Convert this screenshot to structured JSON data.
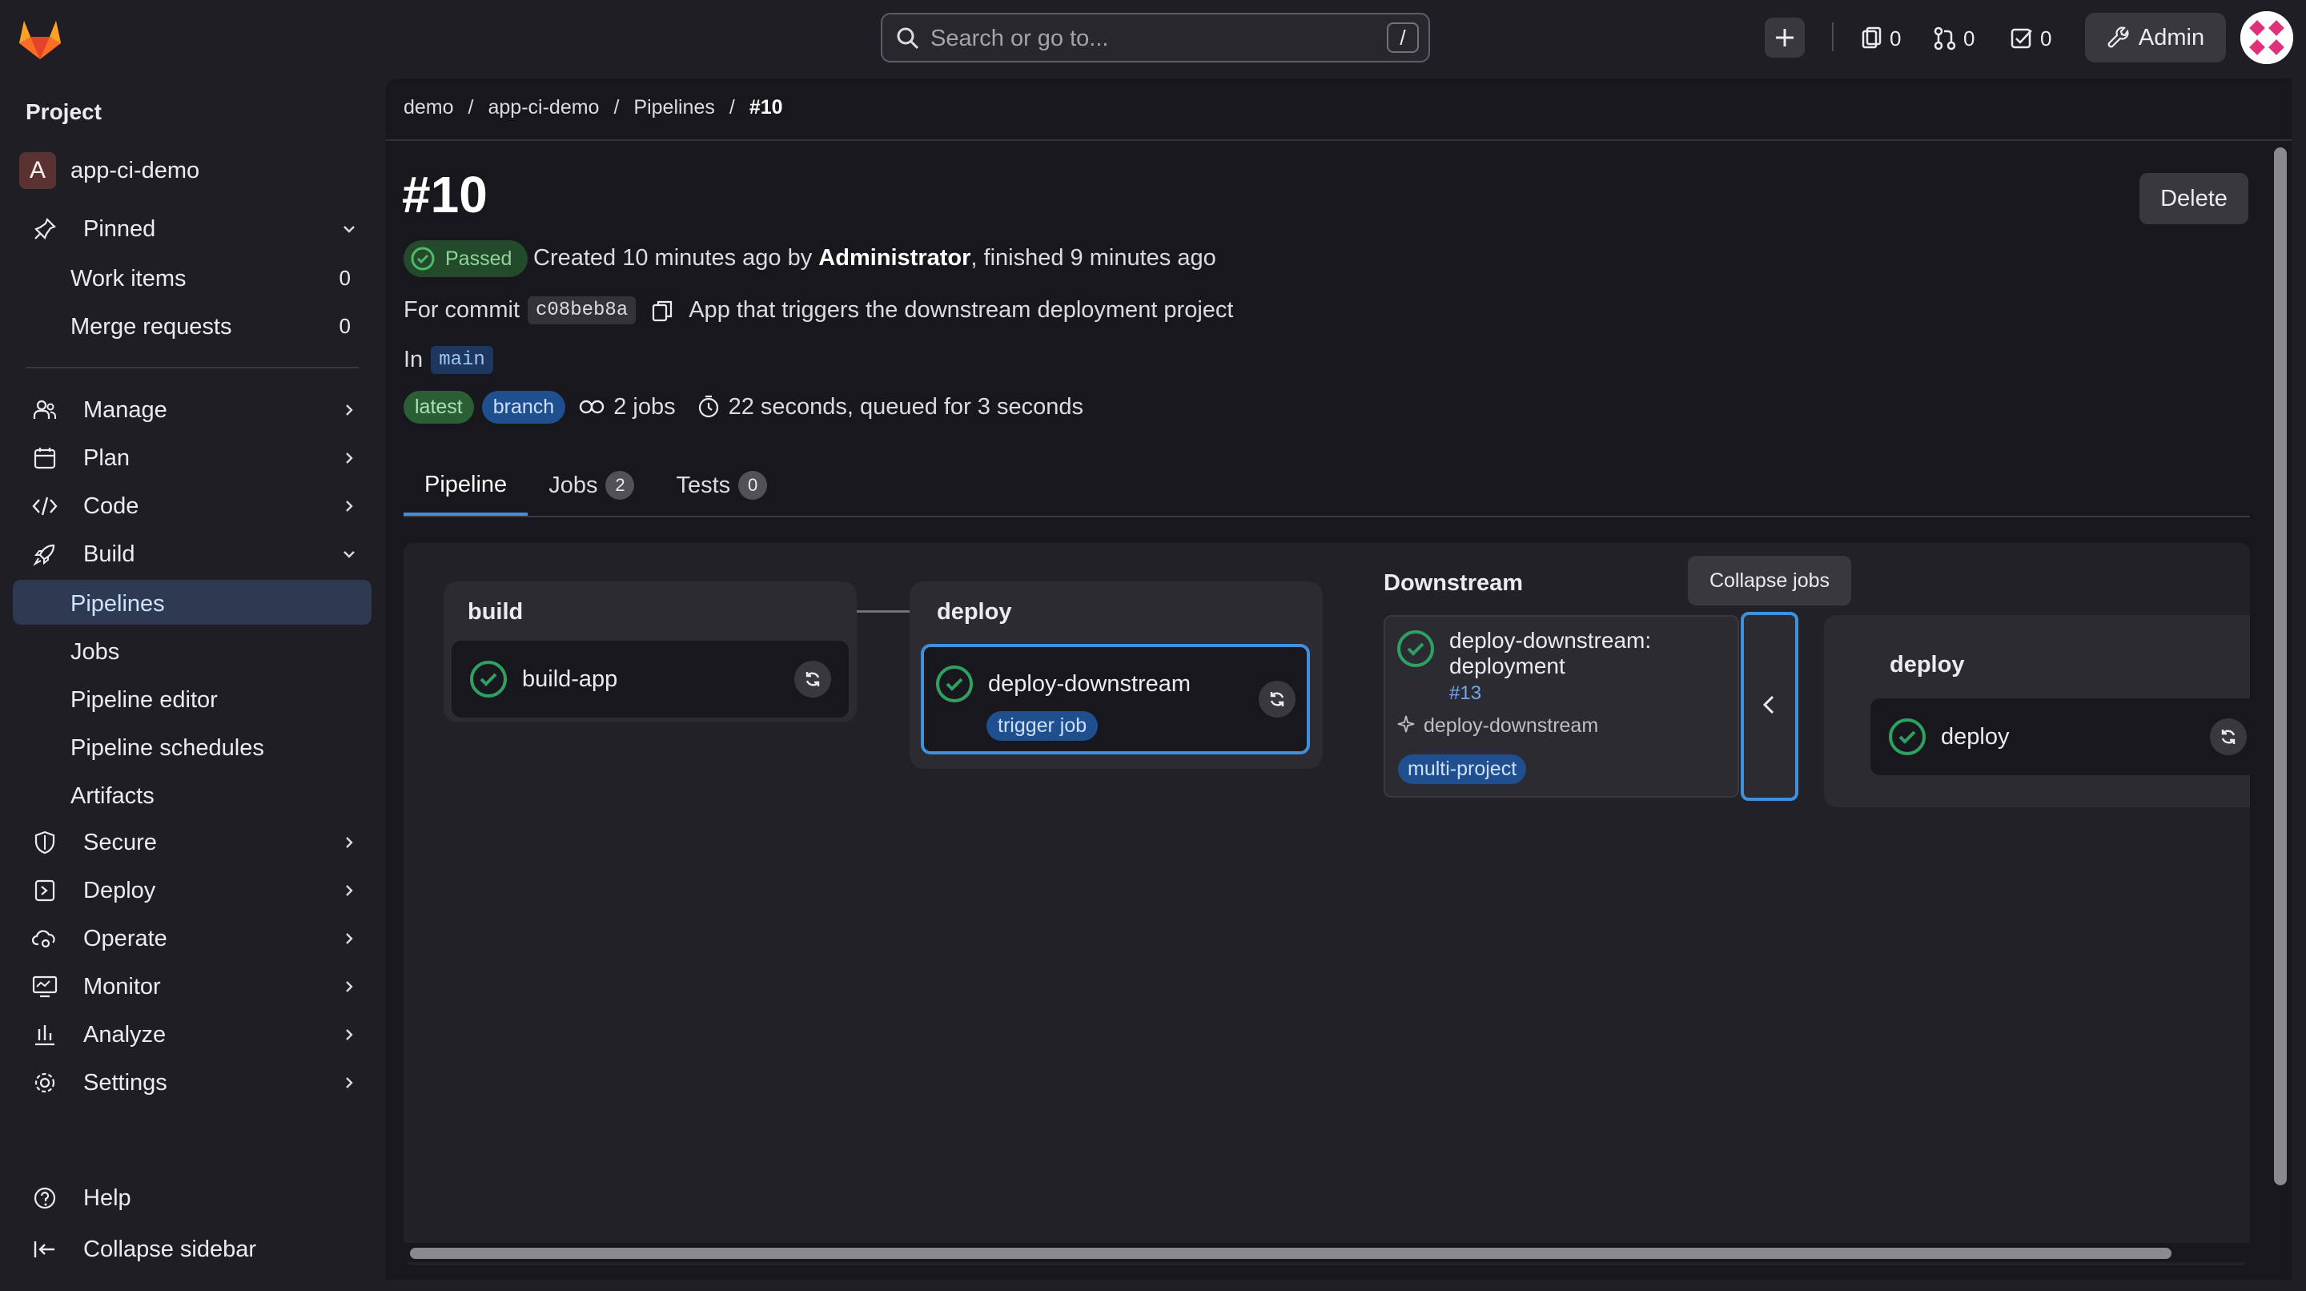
{
  "topbar": {
    "search_placeholder": "Search or go to...",
    "search_shortcut": "/",
    "issues_count": "0",
    "mr_count": "0",
    "todo_count": "0",
    "admin_label": "Admin"
  },
  "sidebar": {
    "section_title": "Project",
    "project_initial": "A",
    "project_name": "app-ci-demo",
    "pinned_label": "Pinned",
    "pinned_items": [
      {
        "label": "Work items",
        "count": "0"
      },
      {
        "label": "Merge requests",
        "count": "0"
      }
    ],
    "items": [
      {
        "label": "Manage"
      },
      {
        "label": "Plan"
      },
      {
        "label": "Code"
      },
      {
        "label": "Build"
      }
    ],
    "build_sub": [
      {
        "label": "Pipelines"
      },
      {
        "label": "Jobs"
      },
      {
        "label": "Pipeline editor"
      },
      {
        "label": "Pipeline schedules"
      },
      {
        "label": "Artifacts"
      }
    ],
    "items_after": [
      {
        "label": "Secure"
      },
      {
        "label": "Deploy"
      },
      {
        "label": "Operate"
      },
      {
        "label": "Monitor"
      },
      {
        "label": "Analyze"
      },
      {
        "label": "Settings"
      }
    ],
    "help_label": "Help",
    "collapse_label": "Collapse sidebar"
  },
  "breadcrumb": {
    "items": [
      "demo",
      "app-ci-demo",
      "Pipelines"
    ],
    "separator": "/",
    "current": "#10"
  },
  "pipeline": {
    "title": "#10",
    "delete_label": "Delete",
    "status": "Passed",
    "created_prefix": "Created 10 minutes ago by ",
    "created_by": "Administrator",
    "created_suffix": ", finished 9 minutes ago",
    "commit_prefix": "For commit",
    "commit_sha": "c08beb8a",
    "commit_message": "App that triggers the downstream deployment project",
    "in_label": "In",
    "branch": "main",
    "badge_latest": "latest",
    "badge_branch": "branch",
    "jobs_count": "2 jobs",
    "duration": "22 seconds, queued for 3 seconds"
  },
  "tabs": [
    {
      "label": "Pipeline"
    },
    {
      "label": "Jobs",
      "count": "2"
    },
    {
      "label": "Tests",
      "count": "0"
    }
  ],
  "graph": {
    "stage_build": "build",
    "job_build": "build-app",
    "stage_deploy": "deploy",
    "job_deploy": "deploy-downstream",
    "job_deploy_badge": "trigger job",
    "downstream_title": "Downstream",
    "downstream_name_line1": "deploy-downstream:",
    "downstream_name_line2": "deployment",
    "downstream_id": "#13",
    "downstream_source": "deploy-downstream",
    "downstream_badge": "multi-project",
    "tooltip": "Collapse jobs",
    "ds_stage": "deploy",
    "ds_job": "deploy"
  },
  "colors": {
    "success": "#2da160",
    "accent": "#428fdc"
  }
}
